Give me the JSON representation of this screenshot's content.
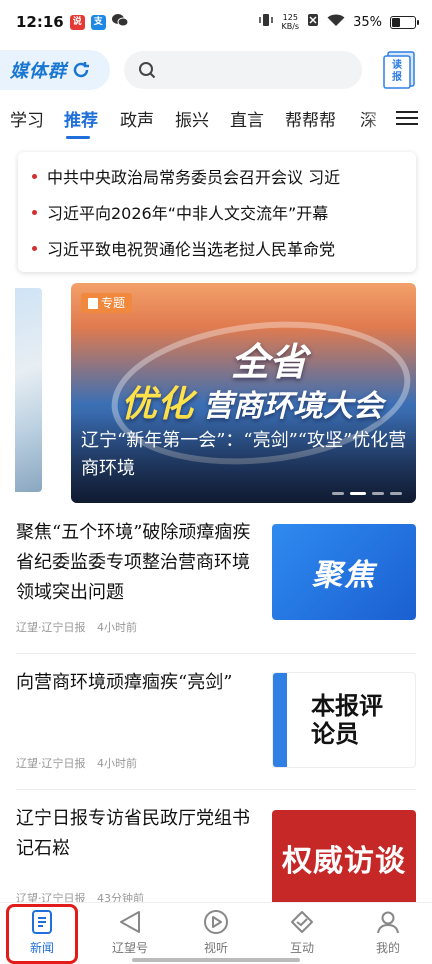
{
  "status_bar": {
    "time": "12:16",
    "speed_value": "125",
    "speed_unit": "KB/s",
    "battery": "35%",
    "app_icons": [
      {
        "name": "app-icon-red",
        "text": "说",
        "color": "#e53935"
      },
      {
        "name": "app-icon-blue",
        "text": "支",
        "color": "#1e88e5"
      }
    ]
  },
  "header": {
    "logo_text": "媒体群",
    "reader_icon_text": "读报"
  },
  "tabs": [
    {
      "label": "学习",
      "active": false
    },
    {
      "label": "推荐",
      "active": true
    },
    {
      "label": "政声",
      "active": false
    },
    {
      "label": "振兴",
      "active": false
    },
    {
      "label": "直言",
      "active": false
    },
    {
      "label": "帮帮帮",
      "active": false
    },
    {
      "label": "深",
      "active": false
    }
  ],
  "headlines": [
    "中共中央政治局常务委员会召开会议 习近",
    "习近平向2026年“中非人文交流年”开幕",
    "习近平致电祝贺通伦当选老挝人民革命党"
  ],
  "banner": {
    "tag": "专题",
    "art_line1": "全省",
    "art_line2": "优化",
    "art_line3": "营商环境大会",
    "caption": "辽宁“新年第一会”：“亮剑”“攻坚”优化营商环境"
  },
  "news": [
    {
      "title": "聚焦“五个环境”破除顽瘴痼疾 省纪委监委专项整治营商环境领域突出问题",
      "source": "辽望·辽宁日报",
      "time": "4小时前",
      "thumb_text": "聚焦"
    },
    {
      "title": "向营商环境顽瘴痼疾“亮剑”",
      "source": "辽望·辽宁日报",
      "time": "4小时前",
      "thumb_text": "本报评论员"
    },
    {
      "title": "辽宁日报专访省民政厅党组书记石崧",
      "source": "辽望·辽宁日报",
      "time": "43分钟前",
      "thumb_text": "权威访谈"
    }
  ],
  "bottom_nav": [
    {
      "label": "新闻",
      "active": true
    },
    {
      "label": "辽望号",
      "active": false
    },
    {
      "label": "视听",
      "active": false
    },
    {
      "label": "互动",
      "active": false
    },
    {
      "label": "我的",
      "active": false
    }
  ],
  "colors": {
    "accent": "#1e6fd9",
    "headline_dot": "#d32f2f",
    "highlight": "#e21b1b"
  }
}
